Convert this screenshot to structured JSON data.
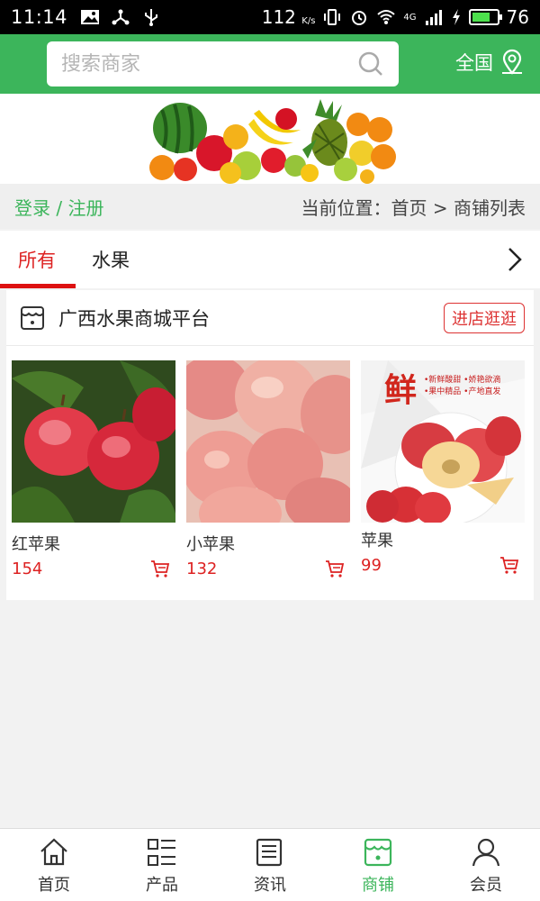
{
  "status_bar": {
    "time": "11:14",
    "speed": "112",
    "speed_unit": "K/s",
    "network": "4G",
    "battery": "76"
  },
  "header": {
    "search_placeholder": "搜索商家",
    "region_label": "全国"
  },
  "breadcrumb": {
    "login_label": "登录 / 注册",
    "location": "当前位置：首页 > 商铺列表"
  },
  "tabs": [
    {
      "label": "所有"
    },
    {
      "label": "水果"
    }
  ],
  "shop": {
    "name": "广西水果商城平台",
    "enter_label": "进店逛逛",
    "products": [
      {
        "name": "红苹果",
        "price": "154"
      },
      {
        "name": "小苹果",
        "price": "132"
      },
      {
        "name": "苹果",
        "price": "99",
        "promo_big": "鲜",
        "promo_lines": [
          "•新鲜酸甜 •娇艳欲滴",
          "•果中精品 •产地直发"
        ]
      }
    ]
  },
  "bottom_nav": [
    {
      "label": "首页",
      "icon": "home-icon"
    },
    {
      "label": "产品",
      "icon": "list-icon"
    },
    {
      "label": "资讯",
      "icon": "news-icon"
    },
    {
      "label": "商铺",
      "icon": "shop-icon"
    },
    {
      "label": "会员",
      "icon": "user-icon"
    }
  ],
  "colors": {
    "primary_green": "#3cb55b",
    "accent_red": "#dd2222"
  }
}
